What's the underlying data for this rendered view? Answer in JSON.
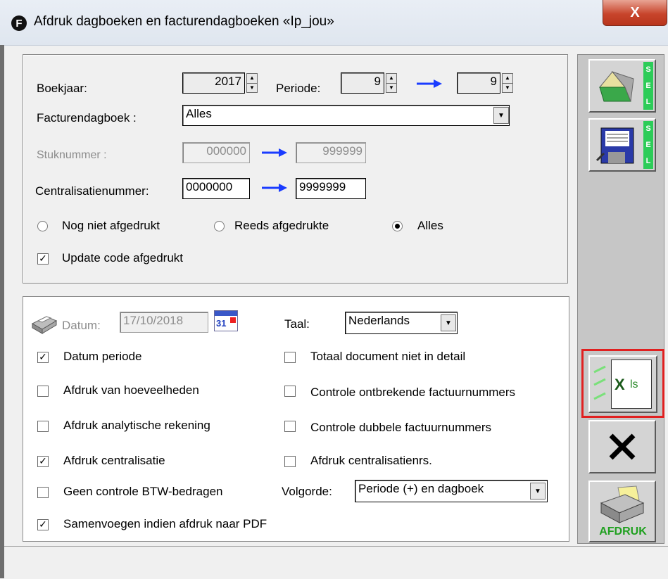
{
  "window": {
    "title": "Afdruk dagboeken en facturendagboeken «Ip_jou»",
    "app_icon_letter": "F",
    "close_label": "X"
  },
  "form": {
    "boekjaar_label": "Boekjaar:",
    "boekjaar_value": "2017",
    "periode_label": "Periode:",
    "periode_from": "9",
    "periode_to": "9",
    "facturendagboek_label": "Facturendagboek :",
    "facturendagboek_value": "Alles",
    "stuknummer_label": "Stuknummer :",
    "stuknummer_from": "000000",
    "stuknummer_to": "999999",
    "centralisatie_label": "Centralisatienummer:",
    "centralisatie_from": "0000000",
    "centralisatie_to": "9999999",
    "radios": [
      {
        "label": "Nog niet afgedrukt",
        "selected": false
      },
      {
        "label": "Reeds afgedrukte",
        "selected": false
      },
      {
        "label": "Alles",
        "selected": true
      }
    ],
    "update_code_label": "Update code afgedrukt",
    "update_code_checked": true
  },
  "options": {
    "datum_label": "Datum:",
    "datum_value": "17/10/2018",
    "calendar_day": "31",
    "taal_label": "Taal:",
    "taal_value": "Nederlands",
    "volgorde_label": "Volgorde:",
    "volgorde_value": "Periode (+) en dagboek",
    "checkboxes_left": [
      {
        "label": "Datum periode",
        "checked": true
      },
      {
        "label": "Afdruk van hoeveelheden",
        "checked": false
      },
      {
        "label": "Afdruk analytische rekening",
        "checked": false
      },
      {
        "label": "Afdruk centralisatie",
        "checked": true
      },
      {
        "label": "Geen controle BTW-bedragen",
        "checked": false
      },
      {
        "label": "Samenvoegen indien afdruk naar PDF",
        "checked": true
      }
    ],
    "checkboxes_right": [
      {
        "label": "Totaal document niet in detail",
        "checked": false
      },
      {
        "label": "Controle ontbrekende factuurnummers",
        "checked": false
      },
      {
        "label": "Controle dubbele factuurnummers",
        "checked": false
      },
      {
        "label": "Afdruk centralisatienrs.",
        "checked": false
      }
    ]
  },
  "toolbar": {
    "sel_label": "SEL",
    "xls_label": "ls",
    "afdruk_label": "AFDRUK",
    "highlight_color": "#e02020"
  }
}
